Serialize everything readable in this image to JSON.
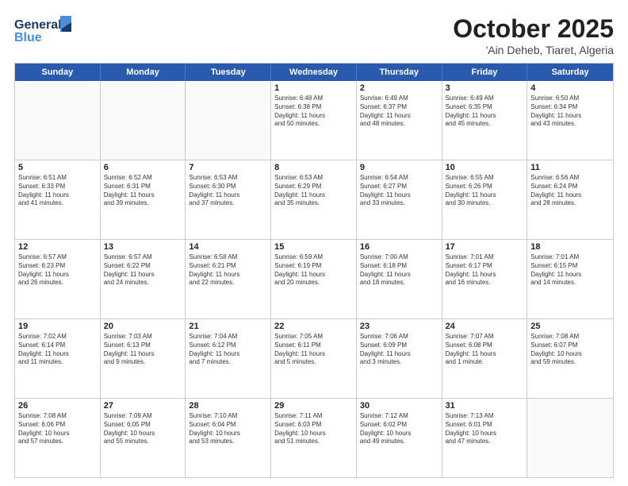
{
  "header": {
    "logo_line1": "General",
    "logo_line2": "Blue",
    "month": "October 2025",
    "location": "'Ain Deheb, Tiaret, Algeria"
  },
  "days_of_week": [
    "Sunday",
    "Monday",
    "Tuesday",
    "Wednesday",
    "Thursday",
    "Friday",
    "Saturday"
  ],
  "weeks": [
    [
      {
        "day": "",
        "info": ""
      },
      {
        "day": "",
        "info": ""
      },
      {
        "day": "",
        "info": ""
      },
      {
        "day": "1",
        "info": "Sunrise: 6:48 AM\nSunset: 6:38 PM\nDaylight: 11 hours\nand 50 minutes."
      },
      {
        "day": "2",
        "info": "Sunrise: 6:49 AM\nSunset: 6:37 PM\nDaylight: 11 hours\nand 48 minutes."
      },
      {
        "day": "3",
        "info": "Sunrise: 6:49 AM\nSunset: 6:35 PM\nDaylight: 11 hours\nand 45 minutes."
      },
      {
        "day": "4",
        "info": "Sunrise: 6:50 AM\nSunset: 6:34 PM\nDaylight: 11 hours\nand 43 minutes."
      }
    ],
    [
      {
        "day": "5",
        "info": "Sunrise: 6:51 AM\nSunset: 6:33 PM\nDaylight: 11 hours\nand 41 minutes."
      },
      {
        "day": "6",
        "info": "Sunrise: 6:52 AM\nSunset: 6:31 PM\nDaylight: 11 hours\nand 39 minutes."
      },
      {
        "day": "7",
        "info": "Sunrise: 6:53 AM\nSunset: 6:30 PM\nDaylight: 11 hours\nand 37 minutes."
      },
      {
        "day": "8",
        "info": "Sunrise: 6:53 AM\nSunset: 6:29 PM\nDaylight: 11 hours\nand 35 minutes."
      },
      {
        "day": "9",
        "info": "Sunrise: 6:54 AM\nSunset: 6:27 PM\nDaylight: 11 hours\nand 33 minutes."
      },
      {
        "day": "10",
        "info": "Sunrise: 6:55 AM\nSunset: 6:26 PM\nDaylight: 11 hours\nand 30 minutes."
      },
      {
        "day": "11",
        "info": "Sunrise: 6:56 AM\nSunset: 6:24 PM\nDaylight: 11 hours\nand 28 minutes."
      }
    ],
    [
      {
        "day": "12",
        "info": "Sunrise: 6:57 AM\nSunset: 6:23 PM\nDaylight: 11 hours\nand 26 minutes."
      },
      {
        "day": "13",
        "info": "Sunrise: 6:57 AM\nSunset: 6:22 PM\nDaylight: 11 hours\nand 24 minutes."
      },
      {
        "day": "14",
        "info": "Sunrise: 6:58 AM\nSunset: 6:21 PM\nDaylight: 11 hours\nand 22 minutes."
      },
      {
        "day": "15",
        "info": "Sunrise: 6:59 AM\nSunset: 6:19 PM\nDaylight: 11 hours\nand 20 minutes."
      },
      {
        "day": "16",
        "info": "Sunrise: 7:00 AM\nSunset: 6:18 PM\nDaylight: 11 hours\nand 18 minutes."
      },
      {
        "day": "17",
        "info": "Sunrise: 7:01 AM\nSunset: 6:17 PM\nDaylight: 11 hours\nand 16 minutes."
      },
      {
        "day": "18",
        "info": "Sunrise: 7:01 AM\nSunset: 6:15 PM\nDaylight: 11 hours\nand 14 minutes."
      }
    ],
    [
      {
        "day": "19",
        "info": "Sunrise: 7:02 AM\nSunset: 6:14 PM\nDaylight: 11 hours\nand 11 minutes."
      },
      {
        "day": "20",
        "info": "Sunrise: 7:03 AM\nSunset: 6:13 PM\nDaylight: 11 hours\nand 9 minutes."
      },
      {
        "day": "21",
        "info": "Sunrise: 7:04 AM\nSunset: 6:12 PM\nDaylight: 11 hours\nand 7 minutes."
      },
      {
        "day": "22",
        "info": "Sunrise: 7:05 AM\nSunset: 6:11 PM\nDaylight: 11 hours\nand 5 minutes."
      },
      {
        "day": "23",
        "info": "Sunrise: 7:06 AM\nSunset: 6:09 PM\nDaylight: 11 hours\nand 3 minutes."
      },
      {
        "day": "24",
        "info": "Sunrise: 7:07 AM\nSunset: 6:08 PM\nDaylight: 11 hours\nand 1 minute."
      },
      {
        "day": "25",
        "info": "Sunrise: 7:08 AM\nSunset: 6:07 PM\nDaylight: 10 hours\nand 59 minutes."
      }
    ],
    [
      {
        "day": "26",
        "info": "Sunrise: 7:08 AM\nSunset: 6:06 PM\nDaylight: 10 hours\nand 57 minutes."
      },
      {
        "day": "27",
        "info": "Sunrise: 7:09 AM\nSunset: 6:05 PM\nDaylight: 10 hours\nand 55 minutes."
      },
      {
        "day": "28",
        "info": "Sunrise: 7:10 AM\nSunset: 6:04 PM\nDaylight: 10 hours\nand 53 minutes."
      },
      {
        "day": "29",
        "info": "Sunrise: 7:11 AM\nSunset: 6:03 PM\nDaylight: 10 hours\nand 51 minutes."
      },
      {
        "day": "30",
        "info": "Sunrise: 7:12 AM\nSunset: 6:02 PM\nDaylight: 10 hours\nand 49 minutes."
      },
      {
        "day": "31",
        "info": "Sunrise: 7:13 AM\nSunset: 6:01 PM\nDaylight: 10 hours\nand 47 minutes."
      },
      {
        "day": "",
        "info": ""
      }
    ]
  ]
}
